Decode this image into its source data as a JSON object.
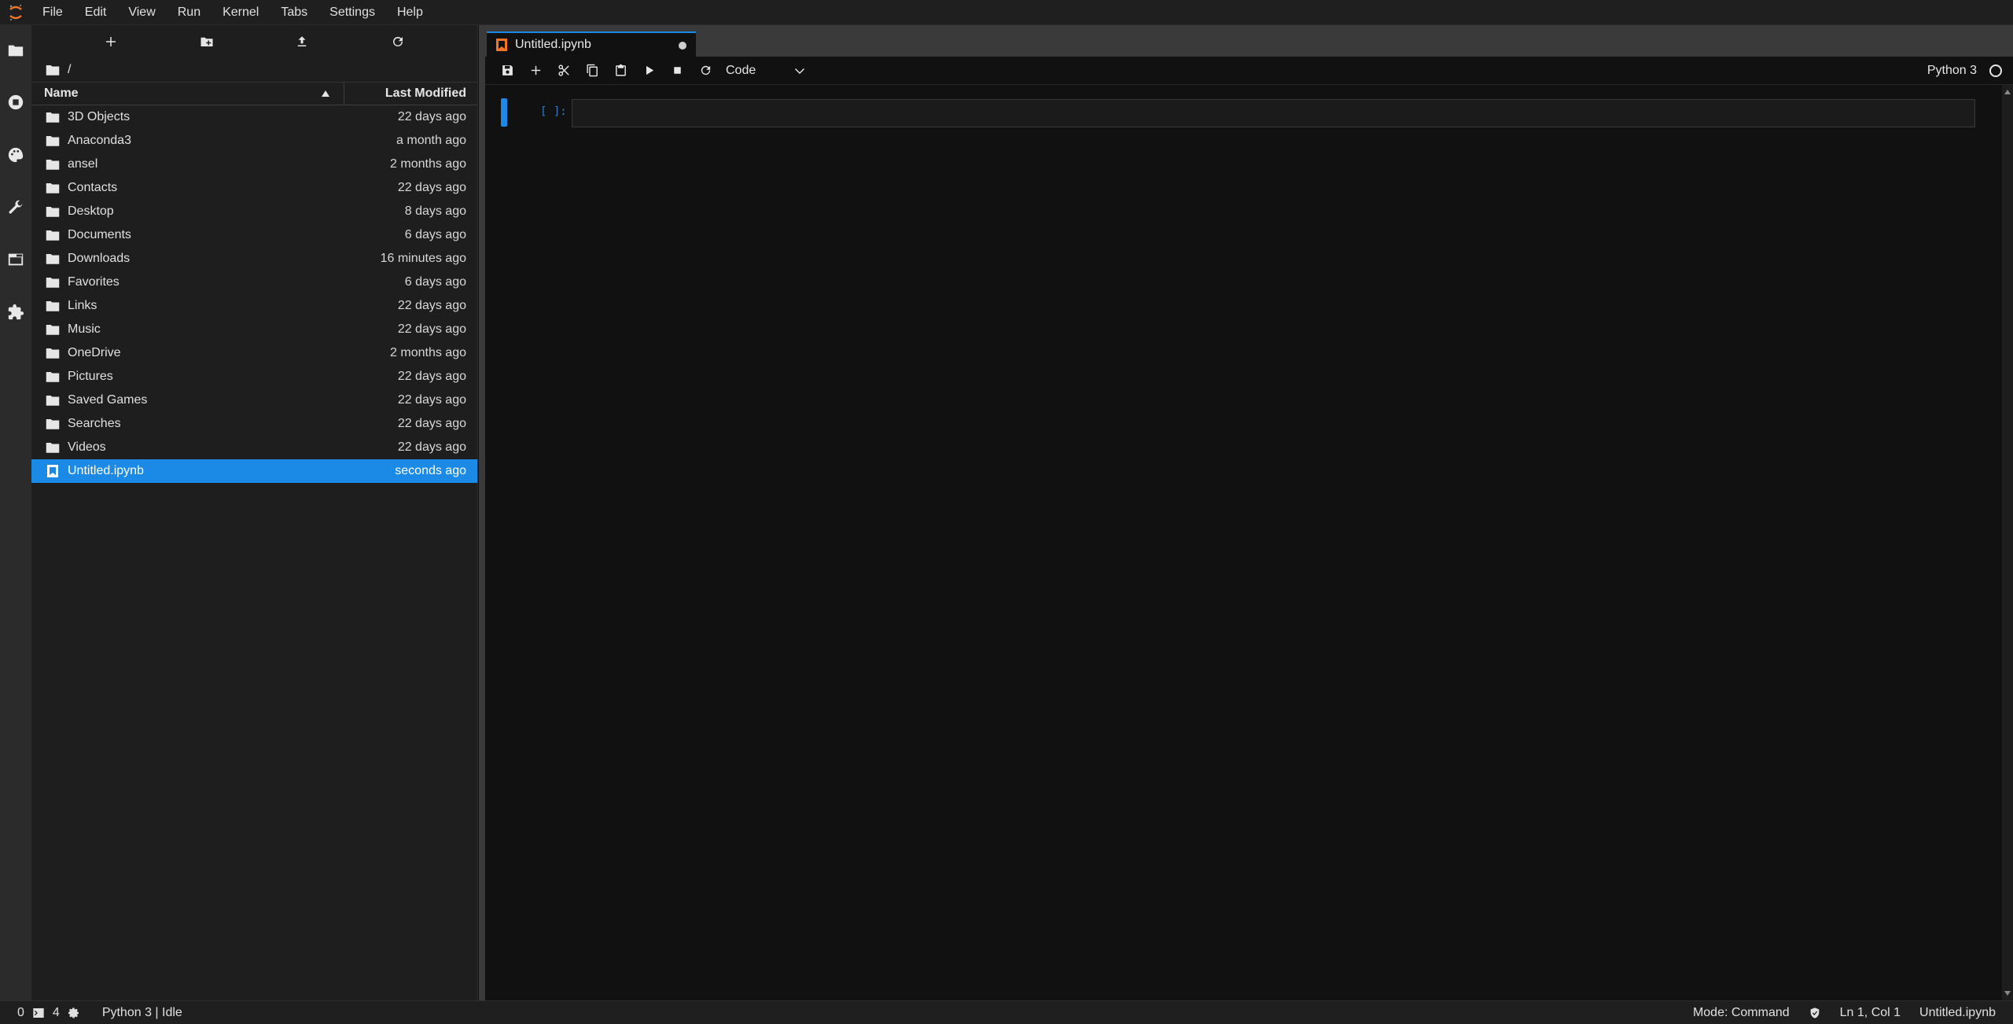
{
  "menu": [
    "File",
    "Edit",
    "View",
    "Run",
    "Kernel",
    "Tabs",
    "Settings",
    "Help"
  ],
  "activitybar": [
    "folder-icon",
    "running-icon",
    "palette-icon",
    "wrench-icon",
    "tabs-icon",
    "extension-icon"
  ],
  "filebrowser": {
    "breadcrumb": "/",
    "columns": {
      "name": "Name",
      "modified": "Last Modified"
    },
    "items": [
      {
        "name": "3D Objects",
        "modified": "22 days ago",
        "type": "folder"
      },
      {
        "name": "Anaconda3",
        "modified": "a month ago",
        "type": "folder"
      },
      {
        "name": "ansel",
        "modified": "2 months ago",
        "type": "folder"
      },
      {
        "name": "Contacts",
        "modified": "22 days ago",
        "type": "folder"
      },
      {
        "name": "Desktop",
        "modified": "8 days ago",
        "type": "folder"
      },
      {
        "name": "Documents",
        "modified": "6 days ago",
        "type": "folder"
      },
      {
        "name": "Downloads",
        "modified": "16 minutes ago",
        "type": "folder"
      },
      {
        "name": "Favorites",
        "modified": "6 days ago",
        "type": "folder"
      },
      {
        "name": "Links",
        "modified": "22 days ago",
        "type": "folder"
      },
      {
        "name": "Music",
        "modified": "22 days ago",
        "type": "folder"
      },
      {
        "name": "OneDrive",
        "modified": "2 months ago",
        "type": "folder"
      },
      {
        "name": "Pictures",
        "modified": "22 days ago",
        "type": "folder"
      },
      {
        "name": "Saved Games",
        "modified": "22 days ago",
        "type": "folder"
      },
      {
        "name": "Searches",
        "modified": "22 days ago",
        "type": "folder"
      },
      {
        "name": "Videos",
        "modified": "22 days ago",
        "type": "folder"
      },
      {
        "name": "Untitled.ipynb",
        "modified": "seconds ago",
        "type": "notebook",
        "selected": true
      }
    ]
  },
  "tab": {
    "title": "Untitled.ipynb"
  },
  "notebook": {
    "cell_type": "Code",
    "kernel": "Python 3",
    "prompt": "[ ]:"
  },
  "status": {
    "terminals": "0",
    "kernels": "4",
    "kernel_state": "Python 3 | Idle",
    "mode": "Mode: Command",
    "position": "Ln 1, Col 1",
    "file": "Untitled.ipynb"
  },
  "colors": {
    "accent": "#1a8ae6",
    "background": "#111111",
    "panel": "#1e1e1e"
  }
}
